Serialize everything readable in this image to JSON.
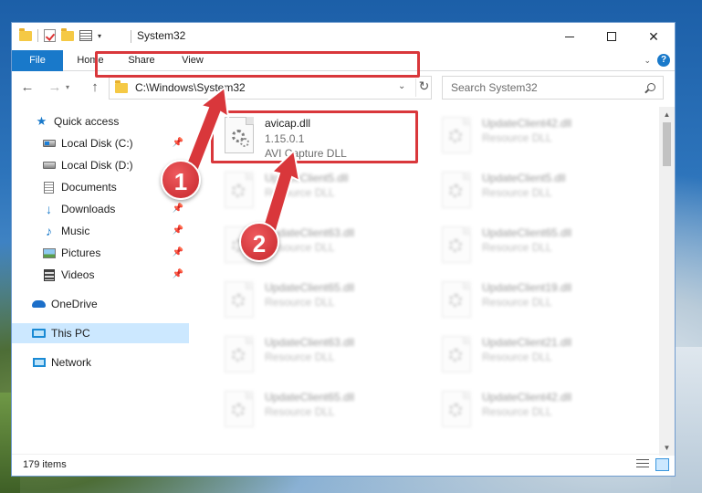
{
  "window": {
    "title": "System32",
    "min_label": "",
    "close_label": "✕"
  },
  "ribbon": {
    "tabs": [
      "File",
      "Home",
      "Share",
      "View"
    ],
    "help": "?"
  },
  "nav": {
    "address": "C:\\Windows\\System32",
    "search_placeholder": "Search System32"
  },
  "sidebar": {
    "items": [
      {
        "label": "Quick access",
        "icon": "star-icon"
      },
      {
        "label": "Local Disk (C:)",
        "icon": "local-disk-icon",
        "pinned": true
      },
      {
        "label": "Local Disk (D:)",
        "icon": "local-disk-icon",
        "pinned": false
      },
      {
        "label": "Documents",
        "icon": "documents-icon",
        "pinned": false
      },
      {
        "label": "Downloads",
        "icon": "downloads-icon",
        "pinned": true
      },
      {
        "label": "Music",
        "icon": "music-icon",
        "pinned": true
      },
      {
        "label": "Pictures",
        "icon": "pictures-icon",
        "pinned": true
      },
      {
        "label": "Videos",
        "icon": "videos-icon",
        "pinned": true
      },
      {
        "label": "OneDrive",
        "icon": "onedrive-icon"
      },
      {
        "label": "This PC",
        "icon": "this-pc-icon",
        "selected": true
      },
      {
        "label": "Network",
        "icon": "network-icon"
      }
    ]
  },
  "files": {
    "highlighted": {
      "name": "avicap.dll",
      "version": "1.15.0.1",
      "description": "AVI Capture DLL"
    },
    "left_column": [
      {
        "name": "UpdateClient5.dll",
        "type": "Resource DLL"
      },
      {
        "name": "UpdateClient63.dll",
        "type": "Resource DLL"
      },
      {
        "name": "UpdateClient65.dll",
        "type": "Resource DLL"
      },
      {
        "name": "UpdateClient63.dll",
        "type": "Resource DLL"
      },
      {
        "name": "UpdateClient65.dll",
        "type": "Resource DLL"
      }
    ],
    "right_column": [
      {
        "name": "UpdateClient42.dll",
        "type": "Resource DLL"
      },
      {
        "name": "UpdateClient5.dll",
        "type": "Resource DLL"
      },
      {
        "name": "UpdateClient65.dll",
        "type": "Resource DLL"
      },
      {
        "name": "UpdateClient19.dll",
        "type": "Resource DLL"
      },
      {
        "name": "UpdateClient21.dll",
        "type": "Resource DLL"
      },
      {
        "name": "UpdateClient42.dll",
        "type": "Resource DLL"
      }
    ]
  },
  "status": {
    "item_count": "179 items"
  },
  "annotations": {
    "step1": "1",
    "step2": "2",
    "highlight_color": "#d9373b"
  },
  "colors": {
    "accent": "#1979ca",
    "selection": "#cce8ff"
  }
}
